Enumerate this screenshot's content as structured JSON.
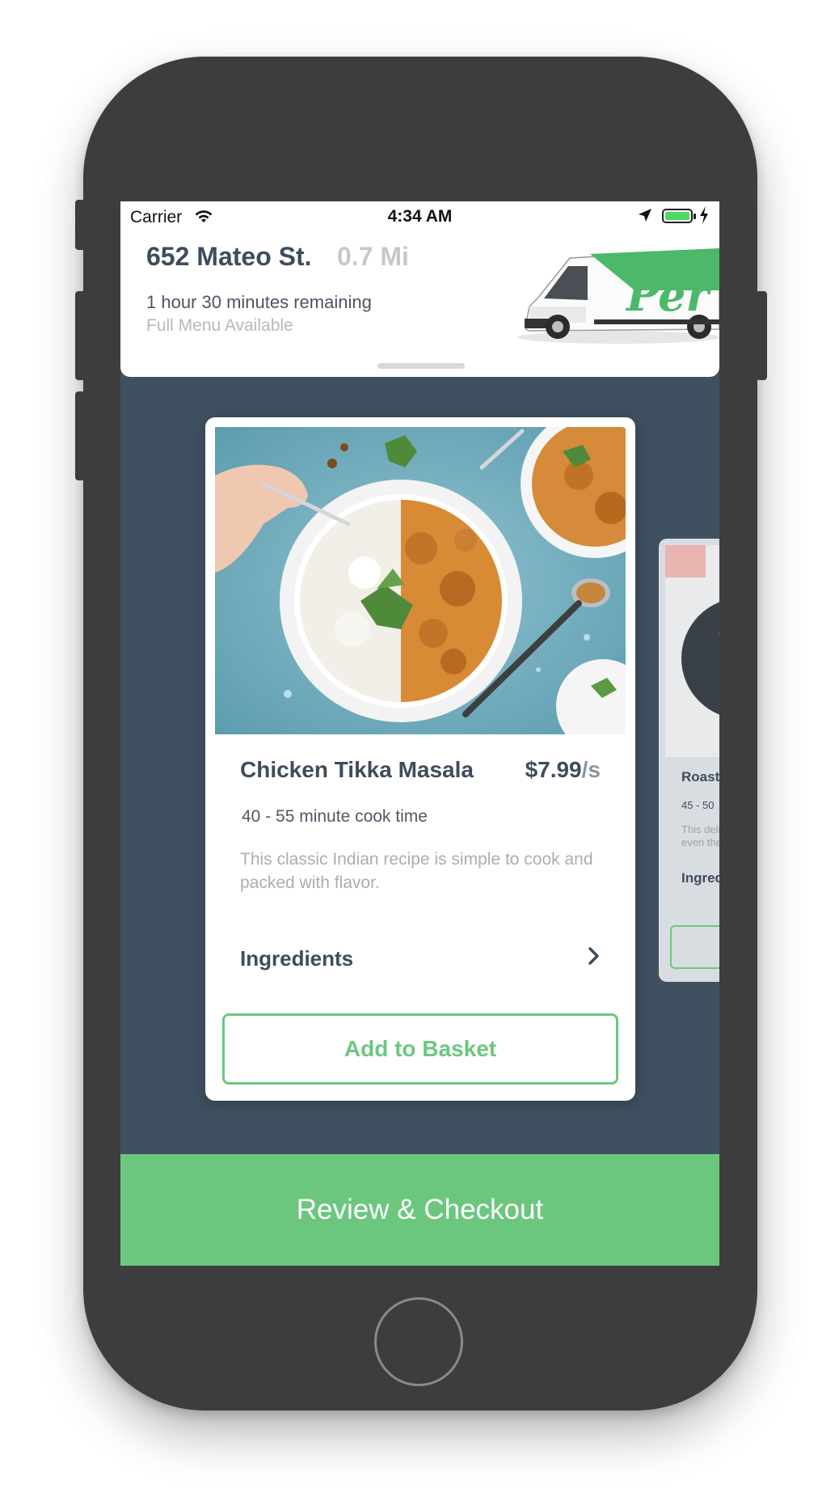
{
  "status_bar": {
    "carrier": "Carrier",
    "time": "4:34 AM",
    "battery_color": "#4cd964"
  },
  "truck": {
    "address": "652 Mateo St.",
    "distance": "0.7 Mi",
    "time_remaining": "1 hour 30 minutes remaining",
    "menu_status": "Full Menu Available",
    "van_logo_text": "Per"
  },
  "recipe": {
    "title": "Chicken Tikka Masala",
    "price": "$7.99",
    "price_unit": "/s",
    "cook_time": "40 - 55 minute cook time",
    "description": "This classic Indian recipe is simple to cook and packed with flavor.",
    "ingredients_label": "Ingredients",
    "add_button_label": "Add to Basket"
  },
  "next_recipe": {
    "title": "Roast",
    "cook_time": "45 - 50",
    "description_line1": "This deli",
    "description_line2": "even the",
    "ingredients_label": "Ingred"
  },
  "checkout": {
    "label": "Review & Checkout"
  },
  "colors": {
    "accent_green": "#6cc77e",
    "screen_bg": "#3f5060",
    "text_dark": "#3f4c5c",
    "phone_body": "#3d3d3d"
  }
}
